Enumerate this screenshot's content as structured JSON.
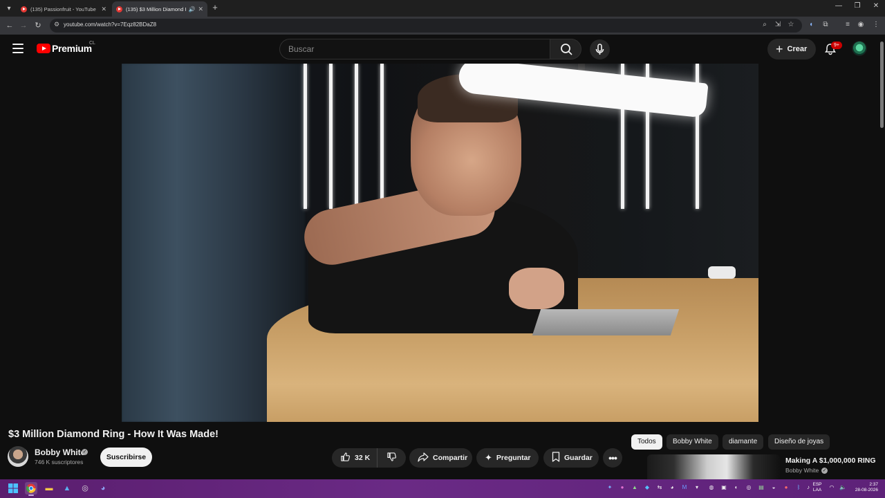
{
  "browser": {
    "tabs": [
      {
        "title": "(135) Passionfruit - YouTube",
        "active": false
      },
      {
        "title": "(135) $3 Million Diamond Ri",
        "active": true
      }
    ],
    "url": "youtube.com/watch?v=7Eqz82BDaZ8"
  },
  "youtube": {
    "logo_text": "Premium",
    "country": "CL",
    "search_placeholder": "Buscar",
    "create_label": "Crear",
    "notifications_badge": "9+"
  },
  "video": {
    "title": "$3 Million Diamond Ring - How It Was Made!",
    "channel": "Bobby White",
    "subscribers": "746 K suscriptores",
    "subscribe_label": "Suscribirse",
    "likes": "32 K",
    "share_label": "Compartir",
    "ask_label": "Preguntar",
    "save_label": "Guardar"
  },
  "chips": [
    "Todos",
    "Bobby White",
    "diamante",
    "Diseño de joyas"
  ],
  "recommendation": {
    "title": "Making A $1,000,000 RING",
    "channel": "Bobby White"
  },
  "taskbar": {
    "language": [
      "ESP",
      "LAA"
    ],
    "time": "2:37",
    "date": "28-08-2026"
  },
  "colors": {
    "yt_red": "#ff0000",
    "background": "#0f0f0f",
    "taskbar": "#6a2a85"
  }
}
